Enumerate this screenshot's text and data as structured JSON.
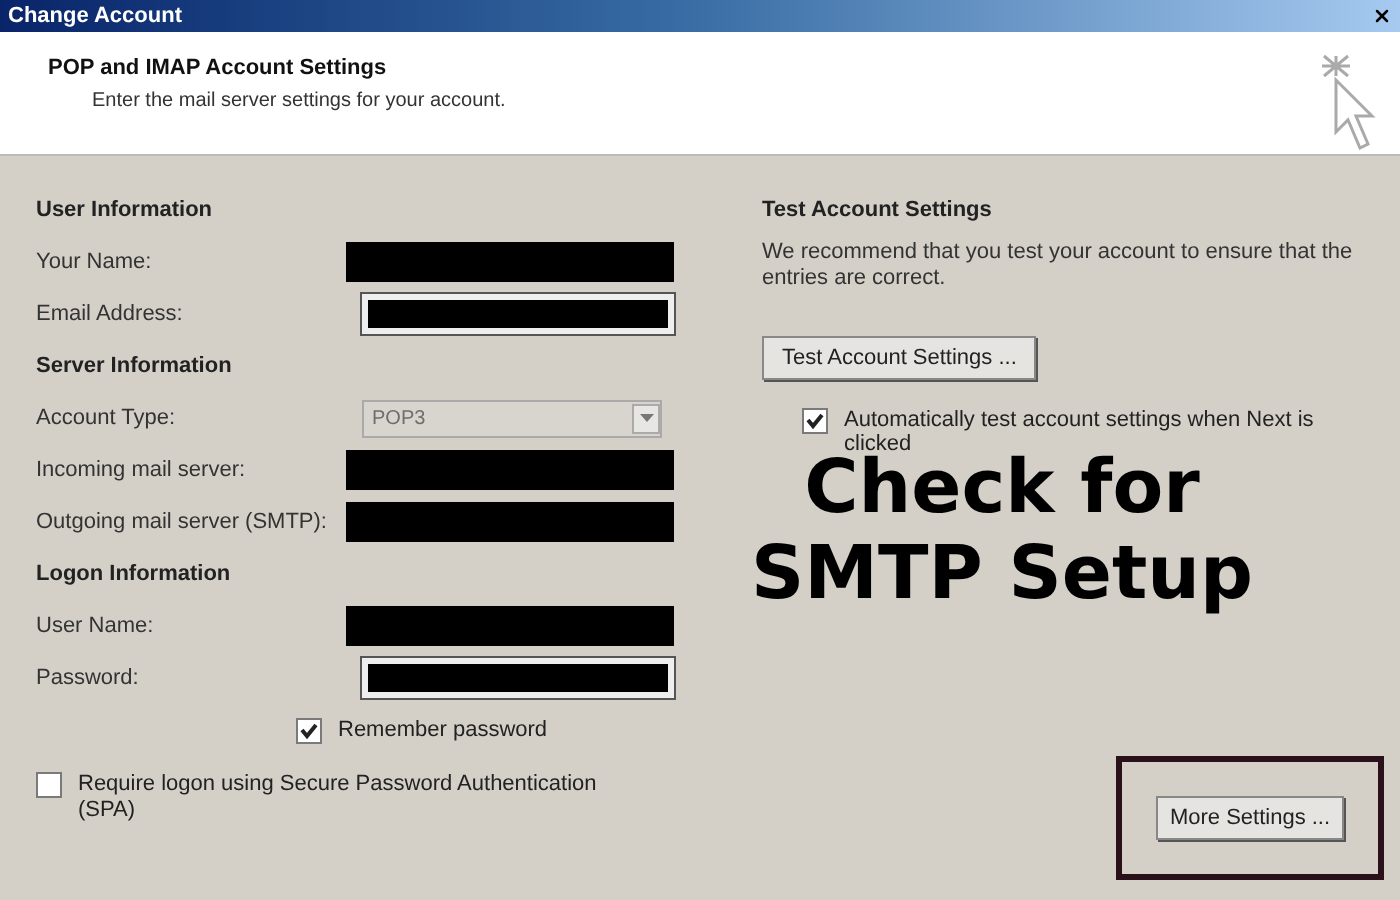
{
  "window": {
    "title": "Change Account"
  },
  "header": {
    "title": "POP and IMAP Account Settings",
    "subtitle": "Enter the mail server settings for your account."
  },
  "left": [
    {
      "kind": "heading",
      "label": "User Information"
    },
    {
      "kind": "redacted",
      "label": "Your Name:"
    },
    {
      "kind": "redacted-framed",
      "label": "Email Address:"
    },
    {
      "kind": "heading",
      "label": "Server Information"
    },
    {
      "kind": "select",
      "label": "Account Type:",
      "value": "POP3",
      "disabled": true
    },
    {
      "kind": "redacted",
      "label": "Incoming mail server:"
    },
    {
      "kind": "redacted",
      "label": "Outgoing mail server (SMTP):"
    },
    {
      "kind": "heading",
      "label": "Logon Information"
    },
    {
      "kind": "redacted",
      "label": "User Name:"
    },
    {
      "kind": "redacted-framed",
      "label": "Password:"
    },
    {
      "kind": "checkbox",
      "label": "Remember password",
      "checked": true
    },
    {
      "kind": "wide-checkbox",
      "label": "Require logon using Secure Password Authentication (SPA)",
      "checked": false
    }
  ],
  "right": {
    "title": "Test Account Settings",
    "description": "We recommend that you test your account to ensure that the entries are correct.",
    "button": "Test Account Settings ...",
    "auto_test": {
      "label": "Automatically test account settings when Next is clicked",
      "checked": true
    }
  },
  "caption": "Check for SMTP Setup",
  "more_settings": "More Settings ..."
}
